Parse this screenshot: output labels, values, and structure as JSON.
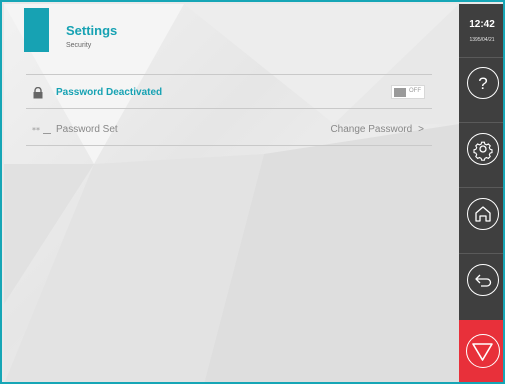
{
  "header": {
    "title": "Settings",
    "subtitle": "Security"
  },
  "rows": [
    {
      "label": "Password Deactivated",
      "toggle_label": "OFF"
    },
    {
      "label": "Password Set",
      "action_label": "Change Password",
      "action_arrow": ">"
    }
  ],
  "sidebar": {
    "time": "12:42",
    "date": "1395/04/21",
    "buttons": [
      "help-icon",
      "gear-icon",
      "home-icon",
      "back-icon"
    ],
    "stop_button": "stop-icon"
  },
  "colors": {
    "accent": "#17a2b3",
    "sidebar": "#3f3f3f",
    "stop": "#e8303a"
  }
}
